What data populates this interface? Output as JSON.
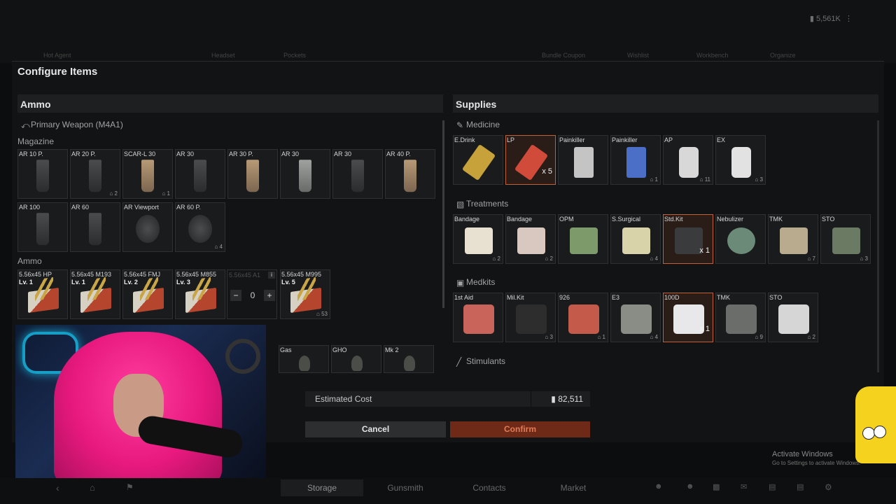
{
  "background": {
    "currency": "5,561K",
    "tabs": [
      "Hot Agent",
      "Headset",
      "Pockets",
      "Bundle Coupon",
      "Wishlist",
      "Workbench",
      "Organize"
    ]
  },
  "modal": {
    "title": "Configure Items"
  },
  "ammo_panel": {
    "title": "Ammo",
    "weapon": "Primary Weapon (M4A1)",
    "magazine_label": "Magazine",
    "magazines": [
      {
        "label": "AR 10 P.",
        "count": "",
        "style": "dark"
      },
      {
        "label": "AR 20 P.",
        "count": "2",
        "style": "dark"
      },
      {
        "label": "SCAR-L 30",
        "count": "1",
        "style": "tan"
      },
      {
        "label": "AR 30",
        "count": "",
        "style": "dark"
      },
      {
        "label": "AR 30 P.",
        "count": "",
        "style": "tan"
      },
      {
        "label": "AR 30",
        "count": "",
        "style": "lt"
      },
      {
        "label": "AR 30",
        "count": "",
        "style": "dark"
      },
      {
        "label": "AR 40 P.",
        "count": "",
        "style": "tan"
      },
      {
        "label": "AR 100",
        "count": "",
        "style": "dark"
      },
      {
        "label": "AR 60",
        "count": "",
        "style": "dark"
      },
      {
        "label": "AR Viewport",
        "count": "",
        "style": "drum"
      },
      {
        "label": "AR 60 P.",
        "count": "4",
        "style": "drum"
      }
    ],
    "ammo_label": "Ammo",
    "ammo": [
      {
        "label": "5.56x45 HP",
        "level": "Lv. 1",
        "count": ""
      },
      {
        "label": "5.56x45 M193",
        "level": "Lv. 1",
        "count": ""
      },
      {
        "label": "5.56x45 FMJ",
        "level": "Lv. 2",
        "count": ""
      },
      {
        "label": "5.56x45 M855",
        "level": "Lv. 3",
        "count": ""
      },
      {
        "label": "5.56x45 M995",
        "level": "Lv. 5",
        "count": "53"
      }
    ],
    "stepper": {
      "label": "5.56x45 A1",
      "value": "0",
      "minus": "−",
      "plus": "+",
      "info": "i"
    },
    "grenades": [
      "Gas",
      "GHO",
      "Mk 2"
    ]
  },
  "supplies_panel": {
    "title": "Supplies",
    "medicine_label": "Medicine",
    "medicine": [
      {
        "label": "E.Drink",
        "count": "",
        "qty": ""
      },
      {
        "label": "LP",
        "count": "",
        "qty": "x 5",
        "selected": true
      },
      {
        "label": "Painkiller",
        "count": "",
        "qty": ""
      },
      {
        "label": "Painkiller",
        "count": "1",
        "qty": ""
      },
      {
        "label": "AP",
        "count": "11",
        "qty": ""
      },
      {
        "label": "EX",
        "count": "3",
        "qty": ""
      }
    ],
    "treatments_label": "Treatments",
    "treatments": [
      {
        "label": "Bandage",
        "count": "2",
        "qty": ""
      },
      {
        "label": "Bandage",
        "count": "2",
        "qty": ""
      },
      {
        "label": "OPM",
        "count": "",
        "qty": ""
      },
      {
        "label": "S.Surgical",
        "count": "4",
        "qty": ""
      },
      {
        "label": "Std.Kit",
        "count": "",
        "qty": "x 1",
        "selected": true
      },
      {
        "label": "Nebulizer",
        "count": "",
        "qty": ""
      },
      {
        "label": "TMK",
        "count": "7",
        "qty": ""
      },
      {
        "label": "STO",
        "count": "3",
        "qty": ""
      }
    ],
    "medkits_label": "Medkits",
    "medkits": [
      {
        "label": "1st Aid",
        "count": "",
        "qty": ""
      },
      {
        "label": "Mil.Kit",
        "count": "3",
        "qty": ""
      },
      {
        "label": "926",
        "count": "1",
        "qty": ""
      },
      {
        "label": "E3",
        "count": "4",
        "qty": ""
      },
      {
        "label": "100D",
        "count": "",
        "qty": "x 1",
        "selected": true
      },
      {
        "label": "TMK",
        "count": "9",
        "qty": ""
      },
      {
        "label": "STO",
        "count": "2",
        "qty": ""
      }
    ],
    "stimulants_label": "Stimulants"
  },
  "footer": {
    "estimated_cost_label": "Estimated Cost",
    "estimated_cost_value": "82,511",
    "cancel": "Cancel",
    "confirm": "Confirm"
  },
  "bottom_nav": [
    "Storage",
    "Gunsmith",
    "Contacts",
    "Market"
  ],
  "windows_notice": {
    "title": "Activate Windows",
    "sub": "Go to Settings to activate Windows."
  },
  "colors": {
    "accent": "#c2603a",
    "confirm_bg": "#6e2a16",
    "confirm_text": "#e07a57"
  }
}
